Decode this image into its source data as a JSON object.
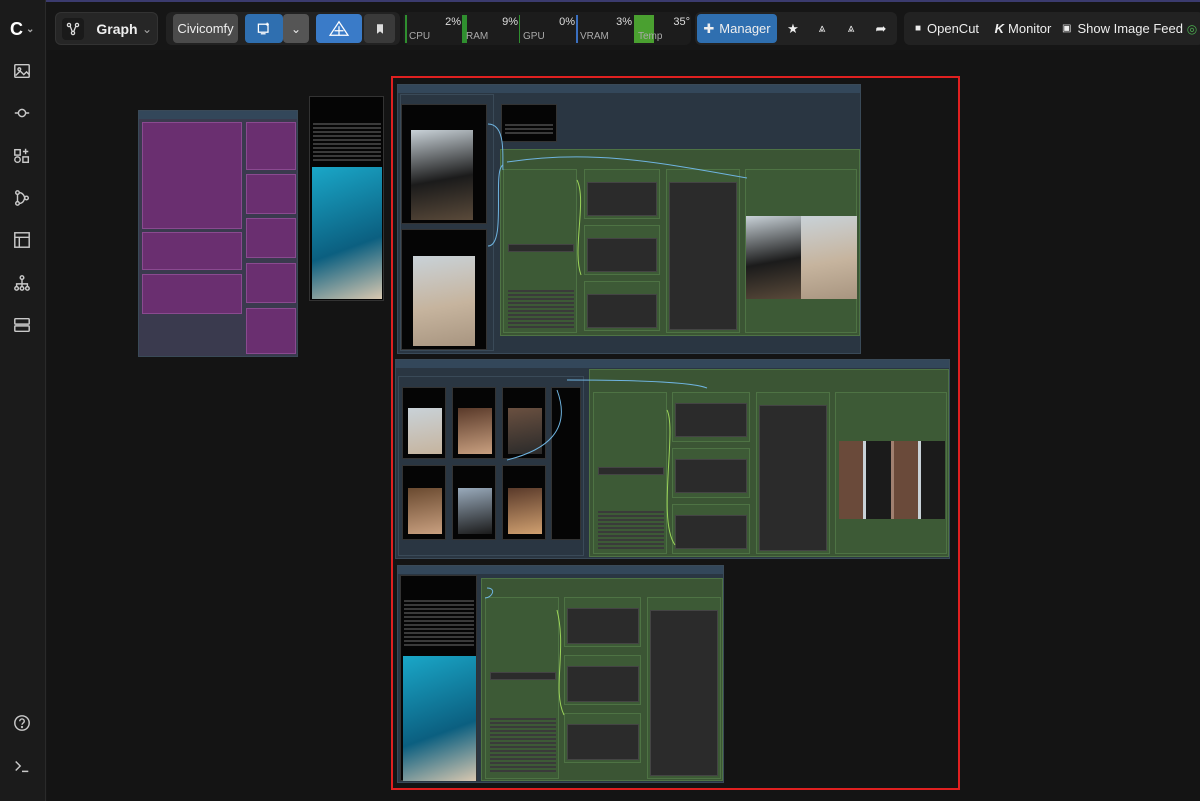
{
  "app": {
    "menu_icon": "comfy-logo-icon"
  },
  "toolbar": {
    "graph_label": "Graph",
    "civicomfy_label": "Civicomfy",
    "manager_label": "Manager",
    "opencut_label": "OpenCut",
    "monitor_label": "Monitor",
    "image_feed_label": "Show Image Feed"
  },
  "stats": [
    {
      "label": "CPU",
      "value": "2%",
      "fill": 0.02
    },
    {
      "label": "RAM",
      "value": "9%",
      "fill": 0.09
    },
    {
      "label": "GPU",
      "value": "0%",
      "fill": 0.0
    },
    {
      "label": "VRAM",
      "value": "3%",
      "fill": 0.03
    },
    {
      "label": "Temp",
      "value": "35°",
      "fill": 0.35
    }
  ],
  "sidebar": {
    "items": [
      "images-icon",
      "queue-icon",
      "node-library-icon",
      "workflows-icon",
      "templates-icon",
      "model-library-icon",
      "layout-icon",
      "help-icon",
      "terminal-icon"
    ]
  },
  "colors": {
    "accent": "#2f6fb0",
    "node_green": "#3d5a36",
    "group_bg": "#2a3642",
    "purple_node": "#6a2f70",
    "highlight": "#e02020"
  }
}
